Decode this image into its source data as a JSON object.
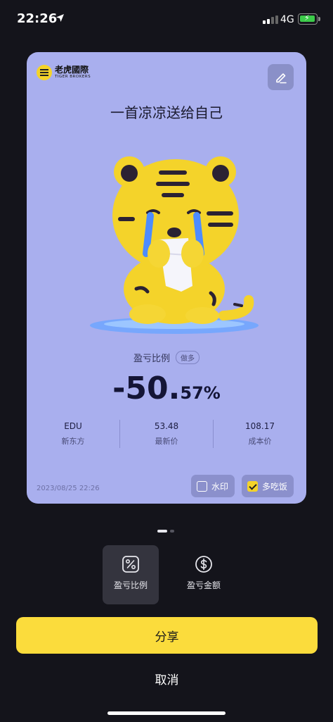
{
  "status_bar": {
    "time": "22:26",
    "network": "4G"
  },
  "card": {
    "brand_name": "老虎國際",
    "brand_sub": "TIGER BROKERS",
    "title": "一首凉凉送给自己",
    "pl_label": "盈亏比例",
    "pl_badge": "做多",
    "pl_value_main": "-50.",
    "pl_value_decimal": "57%",
    "stats": [
      {
        "value": "EDU",
        "label": "新东方"
      },
      {
        "value": "53.48",
        "label": "最新价"
      },
      {
        "value": "108.17",
        "label": "成本价"
      }
    ],
    "timestamp": "2023/08/25 22:26",
    "watermark_label": "水印",
    "dine_label": "多吃饭",
    "colors": {
      "background": "#a9afee",
      "accent": "#fbdc3c"
    }
  },
  "pager": {
    "pages": 2,
    "current": 1
  },
  "tabs": [
    {
      "label": "盈亏比例",
      "icon": "percent-icon",
      "active": true
    },
    {
      "label": "盈亏金额",
      "icon": "dollar-icon",
      "active": false
    }
  ],
  "actions": {
    "share_label": "分享",
    "cancel_label": "取消"
  }
}
